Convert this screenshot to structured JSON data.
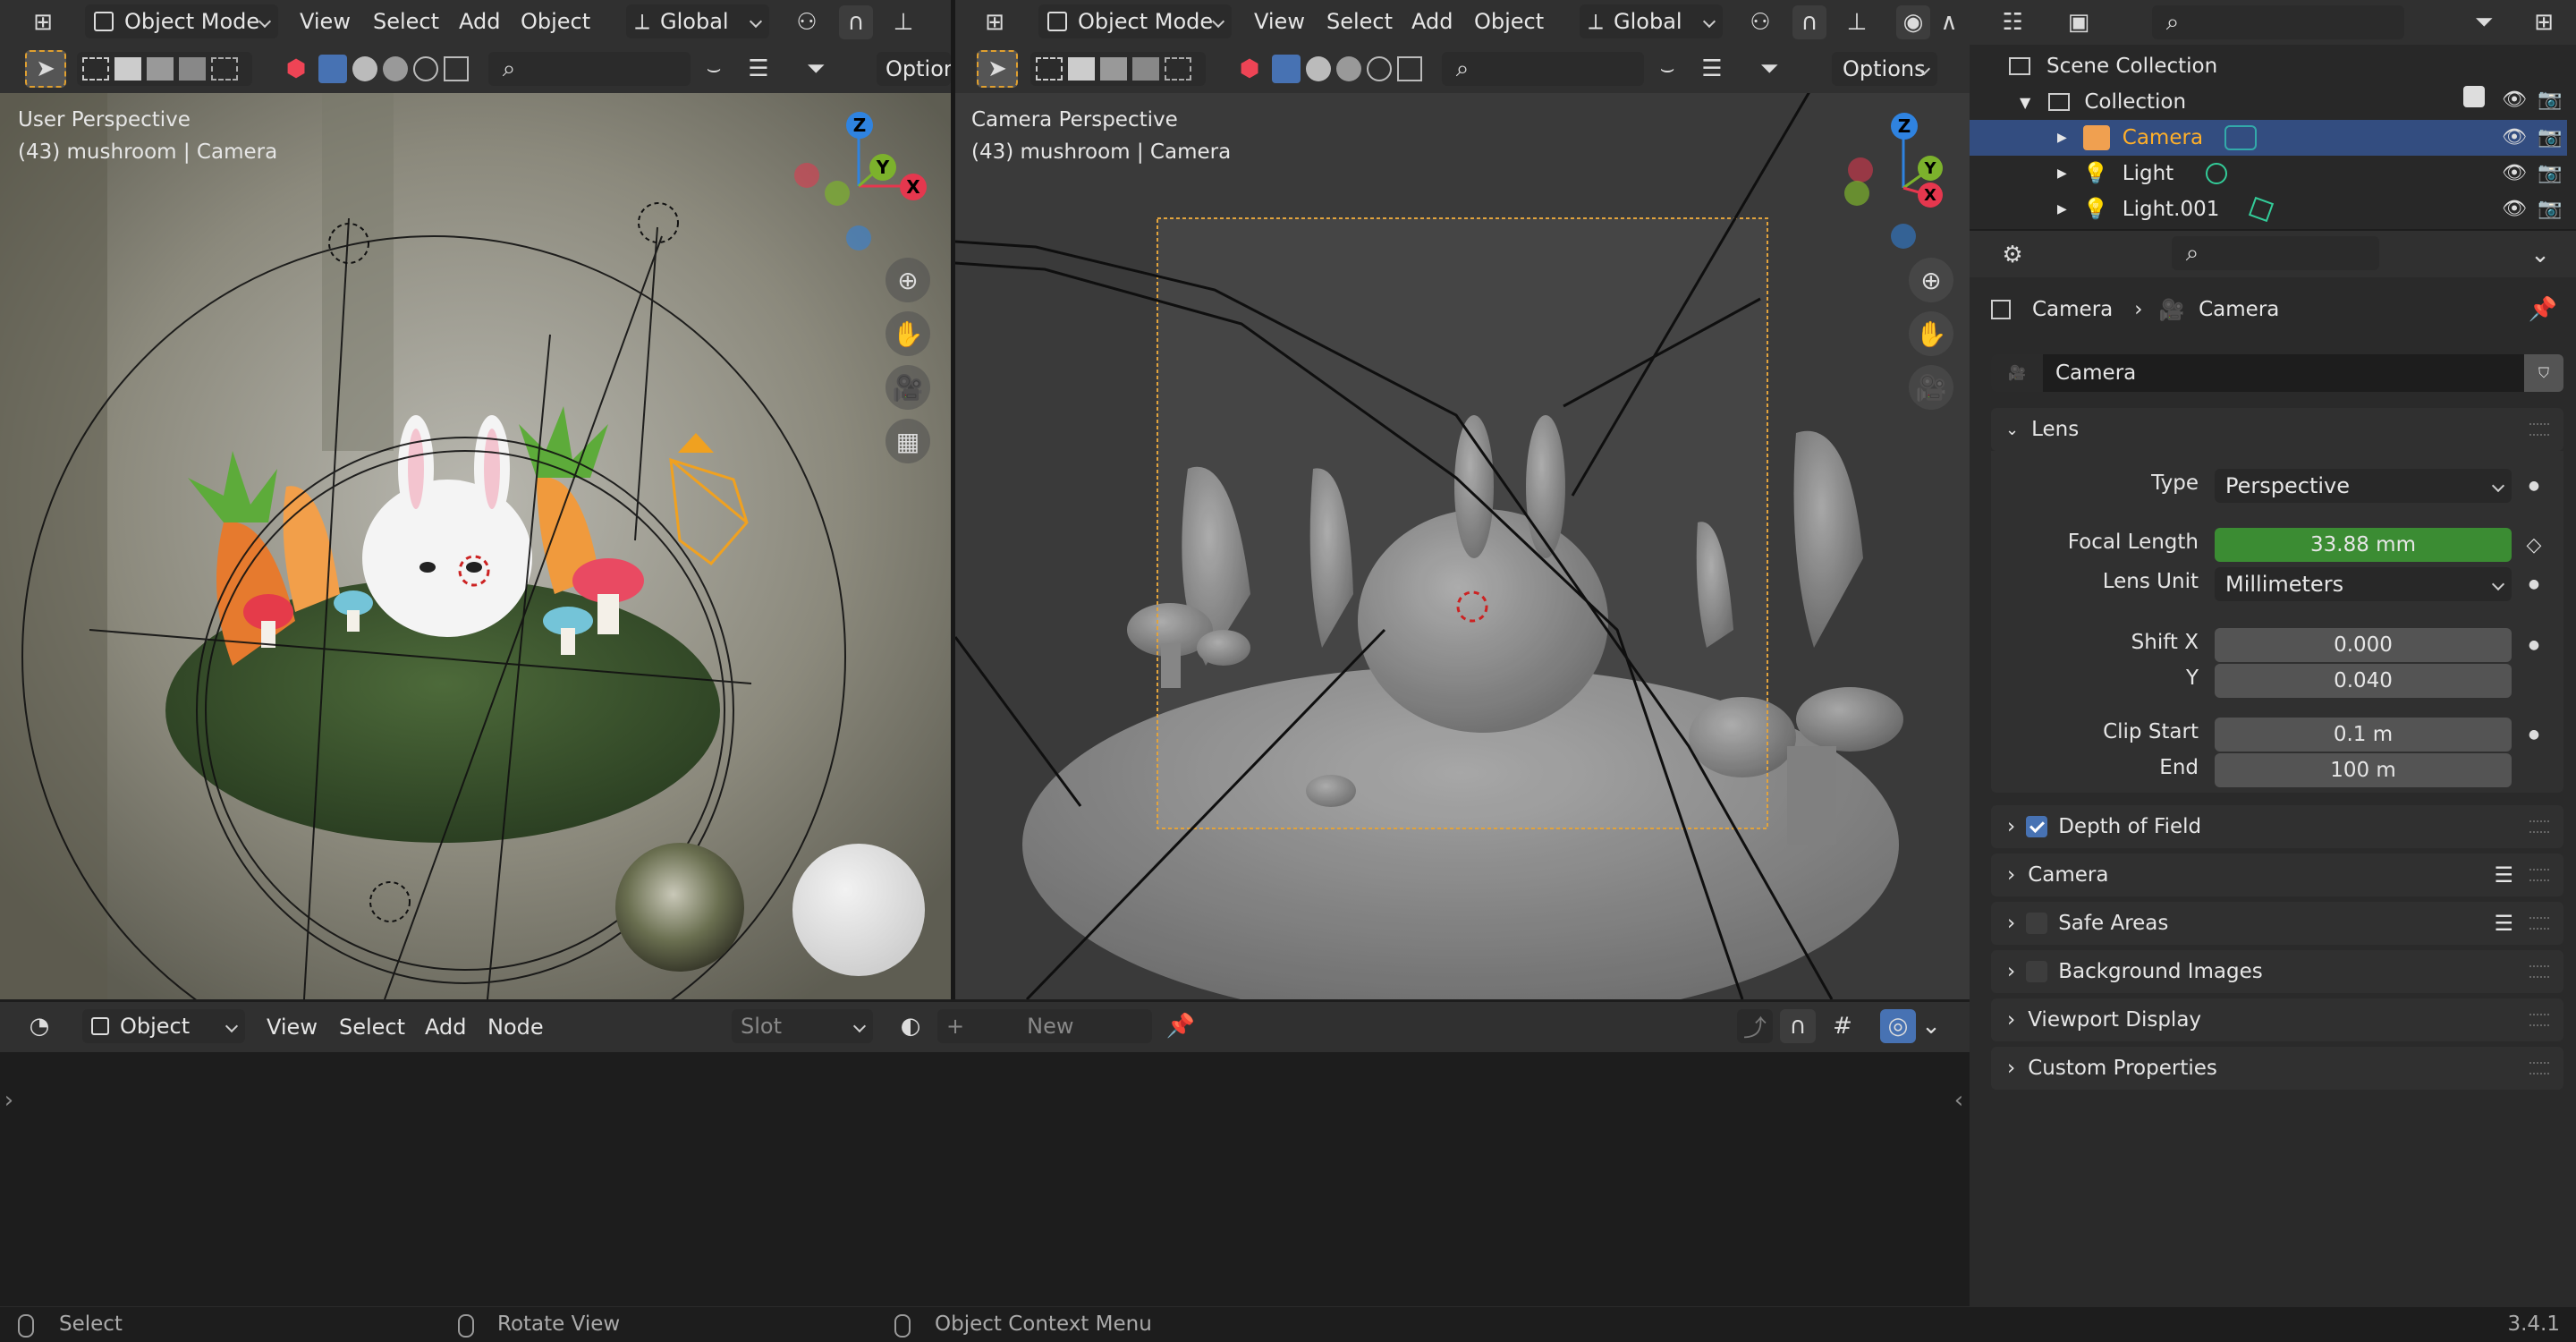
{
  "app": {
    "version": "3.4.1"
  },
  "viewport_left": {
    "mode": "Object Mode",
    "menus": [
      "View",
      "Select",
      "Add",
      "Object"
    ],
    "orientation": "Global",
    "options_label": "Option",
    "title": "User Perspective",
    "subtitle": "(43) mushroom | Camera"
  },
  "viewport_right": {
    "mode": "Object Mode",
    "menus": [
      "View",
      "Select",
      "Add",
      "Object"
    ],
    "orientation": "Global",
    "options_label": "Options",
    "title": "Camera Perspective",
    "subtitle": "(43) mushroom | Camera"
  },
  "gizmo": {
    "x": "X",
    "y": "Y",
    "z": "Z"
  },
  "node_editor": {
    "type": "Object",
    "menus": [
      "View",
      "Select",
      "Add",
      "Node"
    ],
    "slot": "Slot",
    "new_label": "New"
  },
  "status_bar": {
    "items": [
      "Select",
      "Rotate View",
      "Object Context Menu"
    ]
  },
  "outliner": {
    "rows": [
      {
        "label": "Scene Collection"
      },
      {
        "label": "Collection"
      },
      {
        "label": "Camera",
        "selected": true
      },
      {
        "label": "Light"
      },
      {
        "label": "Light.001"
      }
    ]
  },
  "properties": {
    "breadcrumb": [
      "Camera",
      "Camera"
    ],
    "datablock": "Camera",
    "lens_panel": "Lens",
    "fields": {
      "type_label": "Type",
      "type_value": "Perspective",
      "focal_label": "Focal Length",
      "focal_value": "33.88 mm",
      "unit_label": "Lens Unit",
      "unit_value": "Millimeters",
      "shiftx_label": "Shift X",
      "shiftx_value": "0.000",
      "shifty_label": "Y",
      "shifty_value": "0.040",
      "clipstart_label": "Clip Start",
      "clipstart_value": "0.1 m",
      "clipend_label": "End",
      "clipend_value": "100 m"
    },
    "panels": [
      {
        "label": "Depth of Field",
        "checkbox": true,
        "checked": true
      },
      {
        "label": "Camera",
        "checkbox": false
      },
      {
        "label": "Safe Areas",
        "checkbox": true,
        "checked": false
      },
      {
        "label": "Background Images",
        "checkbox": true,
        "checked": false
      },
      {
        "label": "Viewport Display",
        "checkbox": false
      },
      {
        "label": "Custom Properties",
        "checkbox": false
      }
    ]
  },
  "colors": {
    "accent_blue": "#4772b3",
    "focal_green": "#3b8c33",
    "camera_selected_text": "#ffaf29",
    "outliner_selected_row": "#334d80",
    "axis_x": "#e5374e",
    "axis_y": "#7cb22c",
    "axis_z": "#2f83e0"
  }
}
